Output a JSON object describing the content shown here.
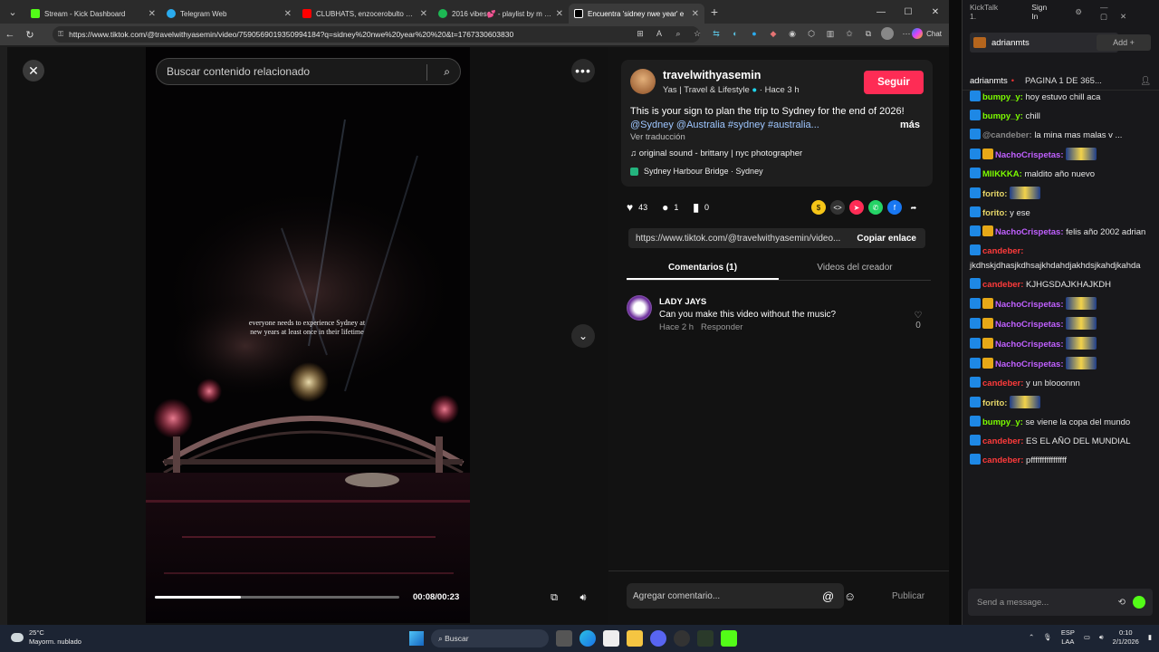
{
  "browser": {
    "tabs": [
      {
        "title": "Stream - Kick Dashboard",
        "color": "#53fc18"
      },
      {
        "title": "Telegram Web",
        "color": "#2aabee"
      },
      {
        "title": "CLUBHATS, enzocerobulto & CLUB",
        "color": "#ff0000"
      },
      {
        "title": "2016 vibes💕 - playlist by m | Spo",
        "color": "#1db954"
      },
      {
        "title": "Encuentra 'sidney nwe year' e",
        "color": "#ffffff"
      }
    ],
    "new_tab": "+",
    "url": "https://www.tiktok.com/@travelwithyasemin/video/7590569019350994184?q=sidney%20nwe%20year%20%20&t=1767330603830",
    "chat_label": "Chat"
  },
  "tiktok": {
    "search_placeholder": "Buscar contenido relacionado",
    "video_overlay_text": "everyone needs to experience Sydney at new years at least once in their lifetime",
    "time": "00:08/00:23",
    "progress": 0.35,
    "author": {
      "username": "travelwithyasemin",
      "subtitle": "Yas | Travel & Lifestyle",
      "posted": "Hace 3 h",
      "follow_label": "Seguir"
    },
    "description": "This is your sign to plan the trip to Sydney for the end of 2026!",
    "hashtags": "@Sydney @Australia #sydney #australia...",
    "more_label": "más",
    "translate_label": "Ver traducción",
    "sound": "original sound - brittany | nyc photographer",
    "location": "Sydney Harbour Bridge · Sydney",
    "likes": "43",
    "comments_count": "1",
    "saves": "0",
    "link": "https://www.tiktok.com/@travelwithyasemin/video...",
    "copy_link_label": "Copiar enlace",
    "tab_comments": "Comentarios (1)",
    "tab_creator": "Videos del creador",
    "comment": {
      "name": "LADY JAYS",
      "text": "Can you make this video without the music?",
      "time": "Hace 2 h",
      "reply": "Responder",
      "likes": "0"
    },
    "add_comment_placeholder": "Agregar comentario...",
    "publish_label": "Publicar"
  },
  "kick": {
    "app_title": "KickTalk 1.",
    "sign_in": "Sign In",
    "channel": "adrianmts",
    "add_label": "Add +",
    "header_user": "adrianmts",
    "header_page": "PAGINA 1 DE 365...",
    "messages": [
      {
        "user": "bumpy_y:",
        "color": "#7cfc00",
        "text": "hoy estuvo chill aca"
      },
      {
        "user": "bumpy_y:",
        "color": "#7cfc00",
        "text": "chill"
      },
      {
        "user": "@candeber:",
        "color": "#888888",
        "text": "la mina mas malas v ..."
      },
      {
        "user": "NachoCrispetas:",
        "color": "#c060ff",
        "text": ""
      },
      {
        "user": "MIIKKKA:",
        "color": "#7cfc00",
        "text": "maldito año nuevo"
      },
      {
        "user": "forito:",
        "color": "#e8d86a",
        "text": ""
      },
      {
        "user": "forito:",
        "color": "#e8d86a",
        "text": "y ese"
      },
      {
        "user": "NachoCrispetas:",
        "color": "#c060ff",
        "text": "felis año 2002 adrian"
      },
      {
        "user": "candeber:",
        "color": "#ff3b3b",
        "text": "jkdhskjdhasjkdhsajkhdahdjakhdsjkahdjkahda"
      },
      {
        "user": "candeber:",
        "color": "#ff3b3b",
        "text": "KJHGSDAJKHAJKDH"
      },
      {
        "user": "NachoCrispetas:",
        "color": "#c060ff",
        "text": ""
      },
      {
        "user": "NachoCrispetas:",
        "color": "#c060ff",
        "text": ""
      },
      {
        "user": "NachoCrispetas:",
        "color": "#c060ff",
        "text": ""
      },
      {
        "user": "NachoCrispetas:",
        "color": "#c060ff",
        "text": ""
      },
      {
        "user": "candeber:",
        "color": "#ff3b3b",
        "text": "y un blooonnn"
      },
      {
        "user": "forito:",
        "color": "#e8d86a",
        "text": ""
      },
      {
        "user": "bumpy_y:",
        "color": "#7cfc00",
        "text": "se viene la copa del mundo"
      },
      {
        "user": "candeber:",
        "color": "#ff3b3b",
        "text": "ES EL AÑO DEL MUNDIAL"
      },
      {
        "user": "candeber:",
        "color": "#ff3b3b",
        "text": "pffffffffffffffff"
      }
    ],
    "send_placeholder": "Send a message..."
  },
  "taskbar": {
    "temp": "25°C",
    "weather": "Mayorm. nublado",
    "search": "Buscar",
    "lang": "ESP",
    "lang2": "LAA",
    "time": "0:10",
    "date": "2/1/2026"
  }
}
